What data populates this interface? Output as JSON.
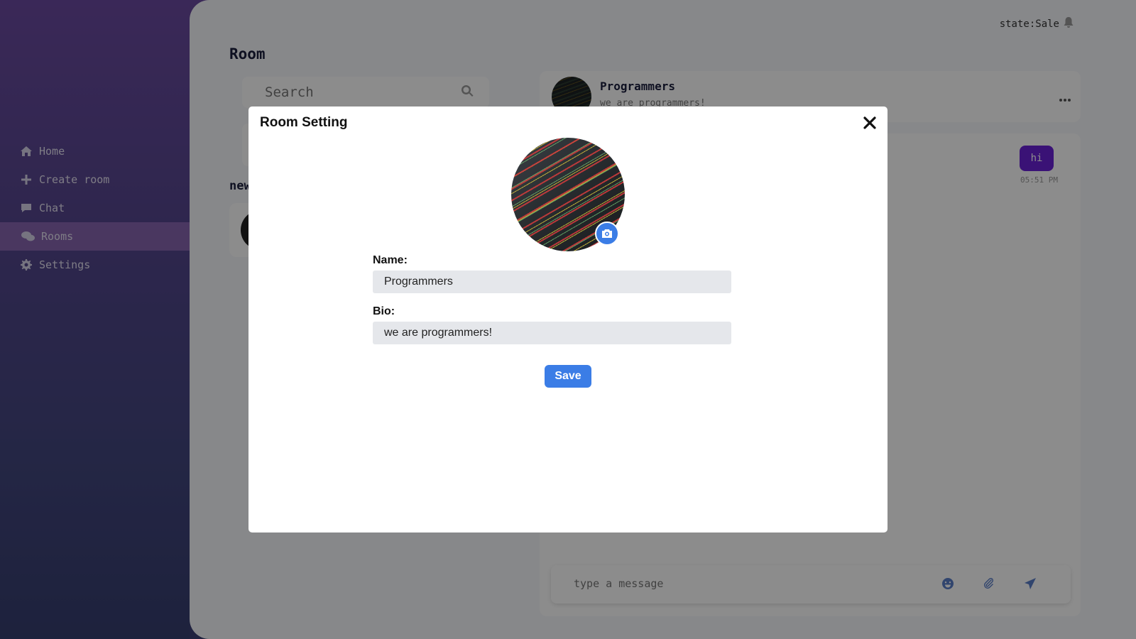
{
  "sidebar": {
    "items": [
      {
        "label": "Home",
        "icon": "home-icon",
        "active": false
      },
      {
        "label": "Create room",
        "icon": "plus-icon",
        "active": false
      },
      {
        "label": "Chat",
        "icon": "chat-icon",
        "active": false
      },
      {
        "label": "Rooms",
        "icon": "comments-icon",
        "active": true
      },
      {
        "label": "Settings",
        "icon": "gear-icon",
        "active": false
      }
    ]
  },
  "header": {
    "state": "state:Sale",
    "page_title": "Room"
  },
  "search": {
    "placeholder": "Search"
  },
  "rooms_list": {
    "section_label": "new"
  },
  "chat": {
    "room_name": "Programmers",
    "room_bio": "we are programmers!",
    "messages": [
      {
        "text": "hi",
        "time": "05:51 PM"
      }
    ],
    "composer_placeholder": "type a message"
  },
  "modal": {
    "title": "Room Setting",
    "name_label": "Name:",
    "name_value": "Programmers",
    "bio_label": "Bio:",
    "bio_value": "we are programmers!",
    "save_label": "Save"
  },
  "colors": {
    "accent": "#3b7de6",
    "bubble": "#6a21d8",
    "sidebar_top": "#6b4aa0",
    "sidebar_bottom": "#363e6f"
  }
}
